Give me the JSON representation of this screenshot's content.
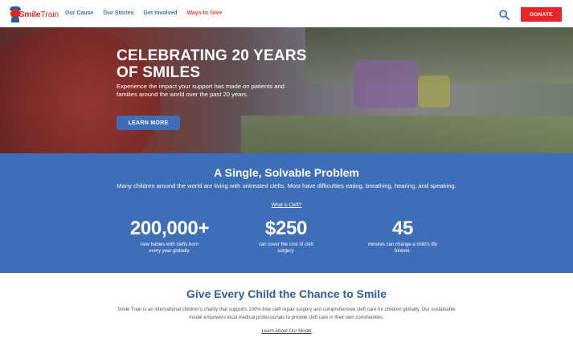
{
  "header": {
    "logo": {
      "brand": "Smile",
      "brand_suffix": "Train"
    },
    "nav": [
      {
        "label": "Our Cause"
      },
      {
        "label": "Our Stories"
      },
      {
        "label": "Get Involved"
      },
      {
        "label": "Ways to Give"
      }
    ],
    "search_icon": "search-icon",
    "donate_label": "DONATE"
  },
  "hero": {
    "title": "CELEBRATING 20 YEARS OF SMILES",
    "subtitle": "Experience the impact your support has made on patients and families around the world over the past 20 years.",
    "button_label": "LEARN MORE"
  },
  "problem": {
    "title": "A Single, Solvable Problem",
    "text": "Many children around the world are living with untreated clefts. Most have difficulties eating, breathing, hearing, and speaking.",
    "link_label": "What is Cleft?",
    "stats": [
      {
        "value": "200,000+",
        "description": "new babies with clefts born every year globally."
      },
      {
        "value": "$250",
        "description": "can cover the cost of cleft surgery."
      },
      {
        "value": "45",
        "description": "minutes can change a child's life forever."
      }
    ]
  },
  "mission": {
    "title": "Give Every Child the Chance to Smile",
    "text": "Smile Train is an international children's charity that supports 100%-free cleft repair surgery and comprehensive cleft care for children globally. Our sustainable model empowers local medical professionals to provide cleft care in their own communities.",
    "link_label": "Learn About Our Model"
  },
  "colors": {
    "brand_red": "#e8262a",
    "brand_blue": "#3e6eb8",
    "nav_blue": "#3a73b8",
    "nav_accent": "#e64a33"
  }
}
